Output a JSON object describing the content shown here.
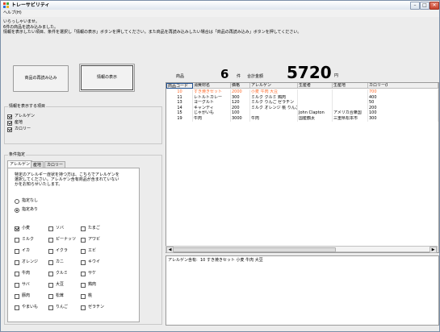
{
  "window": {
    "title": "トレーサビリティ",
    "buttons": {
      "minimize": "–",
      "maximize": "□",
      "close": "✕"
    }
  },
  "menu": {
    "help": "ヘルプ(H)"
  },
  "messages": [
    "いらっしゃいませ。",
    "6件の商品を読み込みました。",
    "情報を表示したい項目、条件を選択し「情報の表示」ボタンを押してください。また商品を再読み込みしたい場合は「商品の再読み込み」ボタンを押してください。"
  ],
  "buttons": {
    "reload": "商品の再読み込み",
    "show": "情報の表示"
  },
  "display_group": {
    "title": "情報を表示する項目",
    "items": [
      {
        "label": "アレルゲン",
        "checked": true
      },
      {
        "label": "産地",
        "checked": true
      },
      {
        "label": "カロリー",
        "checked": true
      }
    ]
  },
  "conditions": {
    "title": "条件指定",
    "tabs": [
      "アレルゲン",
      "産地",
      "カロリー"
    ],
    "description": [
      "特定のアレルギー症状を持つ方は、こちらでアレルゲンを",
      "選択してください。アレルゲン含有商品が含まれていない",
      "かをお知らせいたします。"
    ],
    "radios": [
      {
        "label": "指定なし",
        "selected": false
      },
      {
        "label": "指定あり",
        "selected": true
      }
    ],
    "allergens": [
      {
        "label": "小麦",
        "checked": true
      },
      {
        "label": "ソバ",
        "checked": false
      },
      {
        "label": "たまご",
        "checked": false
      },
      {
        "label": "ミルク",
        "checked": false
      },
      {
        "label": "ピーナッツ",
        "checked": false
      },
      {
        "label": "アワビ",
        "checked": false
      },
      {
        "label": "イカ",
        "checked": false
      },
      {
        "label": "イクラ",
        "checked": false
      },
      {
        "label": "エビ",
        "checked": false
      },
      {
        "label": "オレンジ",
        "checked": false
      },
      {
        "label": "カニ",
        "checked": false
      },
      {
        "label": "キウイ",
        "checked": false
      },
      {
        "label": "牛肉",
        "checked": false
      },
      {
        "label": "クルミ",
        "checked": false
      },
      {
        "label": "サケ",
        "checked": false
      },
      {
        "label": "サバ",
        "checked": false
      },
      {
        "label": "大豆",
        "checked": false
      },
      {
        "label": "鶏肉",
        "checked": false
      },
      {
        "label": "豚肉",
        "checked": false
      },
      {
        "label": "松茸",
        "checked": false
      },
      {
        "label": "桃",
        "checked": false
      },
      {
        "label": "やまいも",
        "checked": false
      },
      {
        "label": "りんご",
        "checked": false
      },
      {
        "label": "ゼラチン",
        "checked": false
      }
    ]
  },
  "summary": {
    "count_label": "商品",
    "count": "6",
    "count_unit": "件",
    "total_label": "合計金額",
    "total": "5720",
    "total_unit": "円"
  },
  "table": {
    "columns": [
      "商品コード",
      "消費材名",
      "価格",
      "アレルゲン",
      "生産者",
      "生産地",
      "カロリー(I"
    ],
    "rows": [
      [
        "10",
        "すき焼きセット",
        "2000",
        "小麦 牛肉 大豆",
        "",
        "",
        "700"
      ],
      [
        "11",
        "レトルトカレー",
        "300",
        "ミルク クルミ 鶏肉",
        "",
        "",
        "400"
      ],
      [
        "13",
        "ヨーグルト",
        "120",
        "ミルク りんご ゼラチン",
        "",
        "",
        "50"
      ],
      [
        "14",
        "キャンディ",
        "200",
        "ミルク オレンジ 桃 りんご",
        "",
        "",
        "200"
      ],
      [
        "15",
        "じゃがいも",
        "100",
        "",
        "John Clapton",
        "アメリカ合衆国",
        "100"
      ],
      [
        "19",
        "牛肉",
        "3000",
        "牛肉",
        "国産鶴太",
        "三重県松本市",
        "300"
      ]
    ],
    "selected_row": 0
  },
  "allergy_result": {
    "label": "アレルゲン含有:",
    "text": "10 すき焼きセット 小麦 牛肉 大豆"
  },
  "colors": {
    "selected_text": "#ff6a2a",
    "grid_border": "#1f4f8f"
  },
  "icons": [
    "app-icon",
    "scroll-left-icon",
    "scroll-right-icon"
  ]
}
